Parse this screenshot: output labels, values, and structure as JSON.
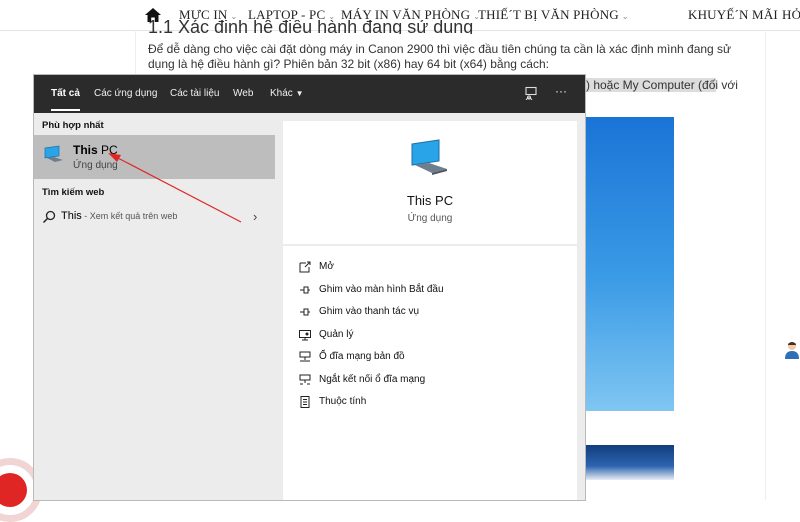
{
  "site_nav": {
    "home_icon": "home-icon",
    "items": [
      {
        "label": "MỰC IN",
        "has_dropdown": true
      },
      {
        "label": "LAPTOP - PC",
        "has_dropdown": true
      },
      {
        "label": "MÁY IN VĂN PHÒNG",
        "has_dropdown": true
      },
      {
        "label": "THIẾ´T BỊ VĂN PHÒNG",
        "has_dropdown": true
      },
      {
        "label": "KHUYẾ´N MÃI",
        "has_dropdown": false
      },
      {
        "label": "HỎ",
        "has_dropdown": false
      }
    ]
  },
  "article": {
    "heading_partial": "1.1 Xác định hệ điều hành đang sử dụng",
    "paragraph": "Để dễ dàng cho việc cài đặt dòng máy in Canon 2900 thì việc đầu tiên chúng ta cần là xác định mình đang sử dụng là hệ điều hành gì? Phiên bản 32 bit (x86) hay 64 bit (x64) bằng cách:",
    "highlight_fragment": ") hoặc My Computer (đối với"
  },
  "search_window": {
    "tabs": [
      {
        "label": "Tất cả",
        "active": true
      },
      {
        "label": "Các ứng dụng",
        "active": false
      },
      {
        "label": "Các tài liệu",
        "active": false
      },
      {
        "label": "Web",
        "active": false
      },
      {
        "label": "Khác",
        "active": false,
        "dropdown_glyph": "▼"
      }
    ],
    "top_icons": [
      "feedback-icon",
      "more-options-icon"
    ],
    "more_glyph": "···",
    "best_match": {
      "section_label": "Phù hợp nhất",
      "title_bold": "This",
      "title_rest": " PC",
      "subtitle": "Ứng dụng",
      "icon": "this-pc-icon"
    },
    "web_search": {
      "section_label": "Tìm kiếm web",
      "query": "This",
      "suffix": " - Xem kết quả trên web",
      "chevron": "›"
    },
    "detail": {
      "title": "This PC",
      "subtitle": "Ứng dụng",
      "actions": [
        {
          "label": "Mở",
          "icon": "open-icon"
        },
        {
          "label": "Ghim vào màn hình Bắt đầu",
          "icon": "pin-start-icon"
        },
        {
          "label": "Ghim vào thanh tác vụ",
          "icon": "pin-taskbar-icon"
        },
        {
          "label": "Quản lý",
          "icon": "manage-icon"
        },
        {
          "label": "Ổ đĩa mạng bản đồ",
          "icon": "map-drive-icon"
        },
        {
          "label": "Ngắt kết nối ổ đĩa mạng",
          "icon": "disconnect-drive-icon"
        },
        {
          "label": "Thuộc tính",
          "icon": "properties-icon"
        }
      ]
    }
  },
  "colors": {
    "window_dark": "#2b2b2b",
    "selection": "#bdbdbd",
    "annotation_arrow": "#e02525"
  }
}
